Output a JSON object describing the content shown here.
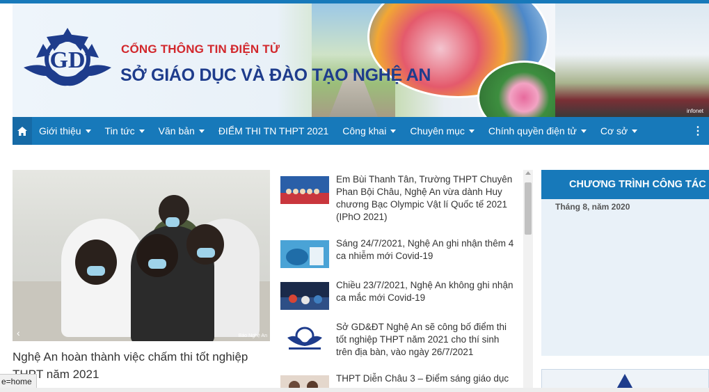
{
  "header": {
    "title_line1": "CỔNG THÔNG TIN ĐIỆN TỬ",
    "title_line2": "SỞ GIÁO DỤC VÀ ĐÀO TẠO NGHỆ AN",
    "banner_watermark": "infonet"
  },
  "nav": {
    "home_icon": "home-icon",
    "items": [
      {
        "label": "Giới thiệu",
        "has_dropdown": true
      },
      {
        "label": "Tin tức",
        "has_dropdown": true
      },
      {
        "label": "Văn bản",
        "has_dropdown": true
      },
      {
        "label": "ĐIỂM THI TN THPT 2021",
        "has_dropdown": false
      },
      {
        "label": "Công khai",
        "has_dropdown": true
      },
      {
        "label": "Chuyên mục",
        "has_dropdown": true
      },
      {
        "label": "Chính quyền điện tử",
        "has_dropdown": true
      },
      {
        "label": "Cơ sở",
        "has_dropdown": true
      }
    ],
    "more_icon": "vertical-ellipsis-icon"
  },
  "featured": {
    "caption": "Nghệ An hoàn thành việc chấm thi tốt nghiệp THPT năm 2021",
    "image_watermark": "Báo Nghệ An",
    "prev_icon": "chevron-left-icon"
  },
  "news": [
    {
      "text": "Em Bùi Thanh Tân, Trường THPT Chuyên Phan Bội Châu, Nghệ An vừa dành Huy chương Bạc Olympic Vật lí Quốc tế 2021 (IPhO 2021)"
    },
    {
      "text": "Sáng 24/7/2021, Nghệ An ghi nhận thêm 4 ca nhiễm mới Covid-19"
    },
    {
      "text": "Chiều 23/7/2021, Nghệ An không ghi nhận ca mắc mới Covid-19"
    },
    {
      "text": "Sở GD&ĐT Nghệ An sẽ công bố điểm thi tốt nghiệp THPT năm 2021 cho thí sinh trên địa bàn, vào ngày 26/7/2021"
    },
    {
      "text": "THPT Diễn Châu 3 – Điểm sáng giáo dục"
    }
  ],
  "sidebar": {
    "heading": "CHƯƠNG TRÌNH CÔNG TÁC",
    "subtitle": "Tháng 8, năm 2020"
  },
  "status": {
    "url_text": "e=home"
  },
  "colors": {
    "nav_bg": "#1779ba",
    "title_red": "#d2272c",
    "title_blue": "#1e3c8c",
    "sidebar_bg": "#e9f1f8"
  }
}
